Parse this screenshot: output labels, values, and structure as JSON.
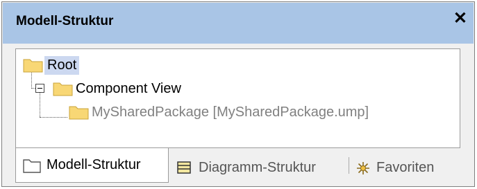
{
  "window": {
    "title": "Modell-Struktur",
    "close_glyph": "✕"
  },
  "tree": {
    "root": {
      "label": "Root",
      "icon": "folder-icon"
    },
    "component_view": {
      "label": "Component View",
      "icon": "folder-icon"
    },
    "shared_package": {
      "label": "MySharedPackage [MySharedPackage.ump]",
      "icon": "folder-icon",
      "color": "#808080"
    }
  },
  "tabs": [
    {
      "label": "Modell-Struktur",
      "icon": "folder-icon",
      "active": true
    },
    {
      "label": "Diagramm-Struktur",
      "icon": "diagram-tree-icon",
      "active": false
    },
    {
      "label": "Favoriten",
      "icon": "favorites-star-icon",
      "active": false
    }
  ],
  "colors": {
    "titlebar": "#a9c5e6",
    "selection": "#ccd8f0",
    "folder": "#f8d775"
  }
}
